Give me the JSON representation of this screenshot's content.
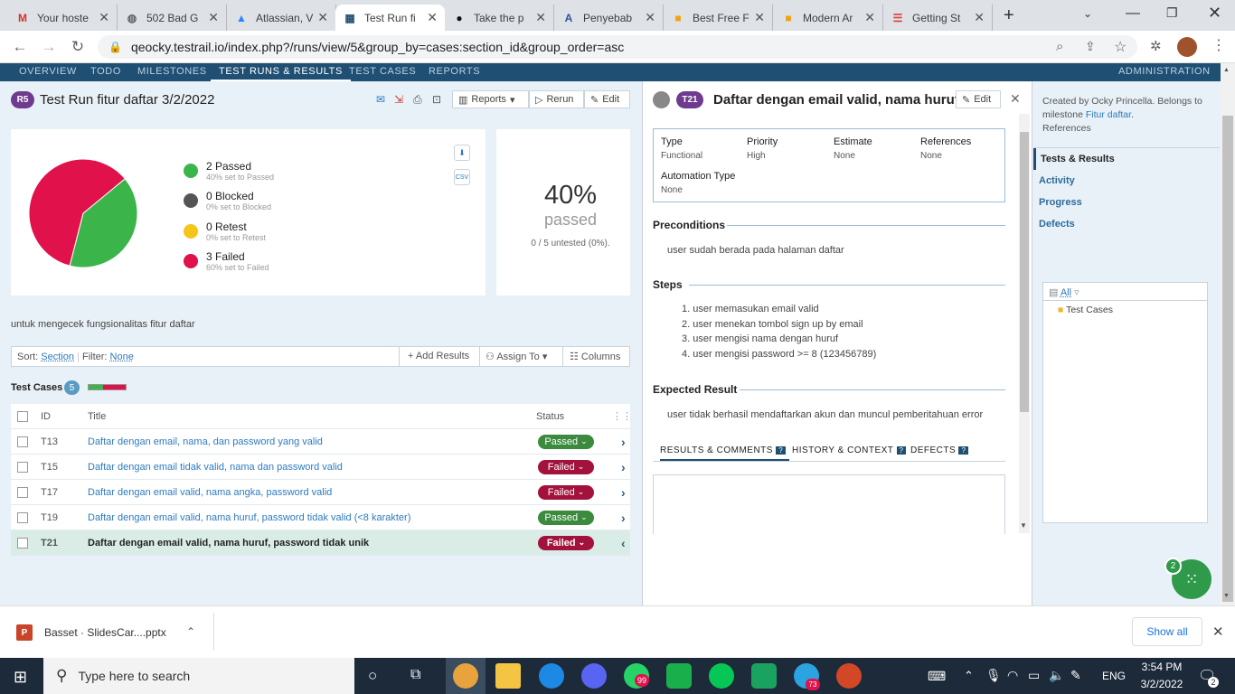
{
  "browser": {
    "tabs": [
      {
        "label": "Your hoste",
        "icon": "gmail-icon",
        "color": "#d93025",
        "glyph": "M"
      },
      {
        "label": "502 Bad G",
        "icon": "globe-icon",
        "color": "#5f6368",
        "glyph": "◍"
      },
      {
        "label": "Atlassian, V",
        "icon": "atlassian-icon",
        "color": "#2684ff",
        "glyph": "▲"
      },
      {
        "label": "Test Run fi",
        "icon": "testrail-icon",
        "color": "#1f4f73",
        "glyph": "▦"
      },
      {
        "label": "Take the p",
        "icon": "circle-icon",
        "color": "#111111",
        "glyph": "●"
      },
      {
        "label": "Penyebab",
        "icon": "a-icon",
        "color": "#2b5797",
        "glyph": "A"
      },
      {
        "label": "Best Free F",
        "icon": "slides-icon",
        "color": "#f4a10b",
        "glyph": "■"
      },
      {
        "label": "Modern Ar",
        "icon": "slides-icon",
        "color": "#f4a10b",
        "glyph": "■"
      },
      {
        "label": "Getting St",
        "icon": "todoist-icon",
        "color": "#db4035",
        "glyph": "☰"
      }
    ],
    "url": "qeocky.testrail.io/index.php?/runs/view/5&group_by=cases:section_id&group_order=asc"
  },
  "appnav": {
    "items": [
      "OVERVIEW",
      "TODO",
      "MILESTONES",
      "TEST RUNS & RESULTS",
      "TEST CASES",
      "REPORTS"
    ],
    "admin": "ADMINISTRATION"
  },
  "run": {
    "badge": "R5",
    "title": "Test Run fitur daftar 3/2/2022",
    "reports": "Reports",
    "rerun": "Rerun",
    "edit": "Edit",
    "description": "untuk mengecek fungsionalitas fitur daftar",
    "percent": "40%",
    "passed_word": "passed",
    "untested": "0 / 5 untested (0%).",
    "legend": [
      {
        "title": "2 Passed",
        "sub": "40% set to Passed",
        "color": "#3bb54a"
      },
      {
        "title": "0 Blocked",
        "sub": "0% set to Blocked",
        "color": "#555555"
      },
      {
        "title": "0 Retest",
        "sub": "0% set to Retest",
        "color": "#f5c518"
      },
      {
        "title": "3 Failed",
        "sub": "60% set to Failed",
        "color": "#e0114b"
      }
    ],
    "csv": "CSV"
  },
  "chart_data": {
    "type": "pie",
    "categories": [
      "Passed",
      "Blocked",
      "Retest",
      "Failed"
    ],
    "values": [
      2,
      0,
      0,
      3
    ],
    "colors": [
      "#3bb54a",
      "#555555",
      "#f5c518",
      "#e0114b"
    ]
  },
  "toolbar": {
    "sort_label": "Sort:",
    "sort_value": "Section",
    "filter_label": "Filter:",
    "filter_value": "None",
    "add_results": "Add Results",
    "assign_to": "Assign To",
    "columns": "Columns"
  },
  "cases": {
    "heading": "Test Cases",
    "count": "5",
    "progress_passed": 0.4,
    "col_id": "ID",
    "col_title": "Title",
    "col_status": "Status",
    "rows": [
      {
        "id": "T13",
        "title": "Daftar dengan email, nama, dan password yang valid",
        "status": "Passed"
      },
      {
        "id": "T15",
        "title": "Daftar dengan email tidak valid, nama dan password valid",
        "status": "Failed"
      },
      {
        "id": "T17",
        "title": "Daftar dengan email valid, nama angka, password valid",
        "status": "Failed"
      },
      {
        "id": "T19",
        "title": "Daftar dengan email valid, nama huruf, password tidak valid (<8 karakter)",
        "status": "Passed"
      },
      {
        "id": "T21",
        "title": "Daftar dengan email valid, nama huruf, password tidak unik",
        "status": "Failed"
      }
    ]
  },
  "detail": {
    "badge": "T21",
    "title": "Daftar dengan email valid, nama huruf...",
    "edit": "Edit",
    "fields": [
      {
        "label": "Type",
        "value": "Functional"
      },
      {
        "label": "Priority",
        "value": "High"
      },
      {
        "label": "Estimate",
        "value": "None"
      },
      {
        "label": "References",
        "value": "None"
      }
    ],
    "automation_label": "Automation Type",
    "automation_value": "None",
    "preconditions_h": "Preconditions",
    "preconditions": "user sudah berada pada halaman daftar",
    "steps_h": "Steps",
    "steps": [
      "user memasukan email valid",
      "user menekan tombol sign up by email",
      "user mengisi nama dengan huruf",
      "user mengisi password >= 8 (123456789)"
    ],
    "expected_h": "Expected Result",
    "expected": "user tidak berhasil mendaftarkan akun dan muncul pemberitahuan error",
    "tabs": [
      "RESULTS & COMMENTS",
      "HISTORY & CONTEXT",
      "DEFECTS"
    ],
    "tab_help": "?"
  },
  "sidebar": {
    "created_prefix": "Created by Ocky Princella. Belongs to milestone ",
    "milestone": "Fitur daftar",
    "created_suffix": ".",
    "references": "References",
    "links": [
      "Tests & Results",
      "Activity",
      "Progress",
      "Defects"
    ],
    "tree_all": "All",
    "tree_folder": "Test Cases",
    "fab_count": "2"
  },
  "downloads": {
    "file": "Basset · SlidesCar....pptx",
    "show_all": "Show all"
  },
  "taskbar": {
    "search": "Type here to search",
    "time": "3:54 PM",
    "date": "3/2/2022",
    "lang": "ENG",
    "whatsapp_badge": "99",
    "telegram_badge": "73",
    "notif_count": "2"
  }
}
